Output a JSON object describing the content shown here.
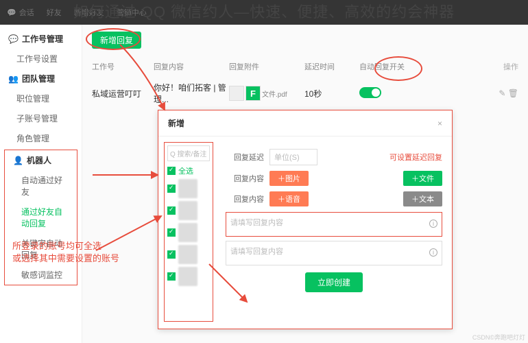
{
  "overlay_title": "如何通过 QQ 微信约人—快速、便捷、高效的约会神器",
  "topnav": {
    "item0": "会话",
    "item1": "好友",
    "item2": "新增好友",
    "item3": "营销中心"
  },
  "sidebar": {
    "group1": "工作号管理",
    "g1_i1": "工作号设置",
    "group2": "团队管理",
    "g2_i1": "职位管理",
    "g2_i2": "子账号管理",
    "g2_i3": "角色管理",
    "group3": "机器人",
    "g3_i1": "自动通过好友",
    "g3_i2": "通过好友自动回复",
    "g3_i3": "关键字自动回复",
    "g3_i4": "敏感词监控"
  },
  "main": {
    "btn_new": "新增回复",
    "head": {
      "c1": "工作号",
      "c2": "回复内容",
      "c3": "回复附件",
      "c4": "延迟时间",
      "c5": "自动回复开关",
      "c6": "操作"
    },
    "row": {
      "c1": "私域运营叮叮",
      "c2": "你好！咱们拓客 | 管理...",
      "file_letter": "F",
      "file_name": "文件.pdf",
      "c4": "10秒"
    }
  },
  "modal": {
    "title": "新增",
    "close": "×",
    "search_ph": "Q 搜索/备注",
    "select_all": "全选",
    "delay_label": "回复延迟",
    "delay_ph": "单位(S)",
    "delay_note": "可设置延迟回复",
    "content_label": "回复内容",
    "btn_img": "＋图片",
    "btn_file": "＋文件",
    "btn_voice": "＋语音",
    "btn_text": "＋文本",
    "ta_ph": "请填写回复内容",
    "btn_create": "立即创建"
  },
  "annot": {
    "left": "所登录的账号均可全选\n或选择其中需要设置的账号"
  },
  "watermark": "CSDN©奔跑吧灯灯"
}
